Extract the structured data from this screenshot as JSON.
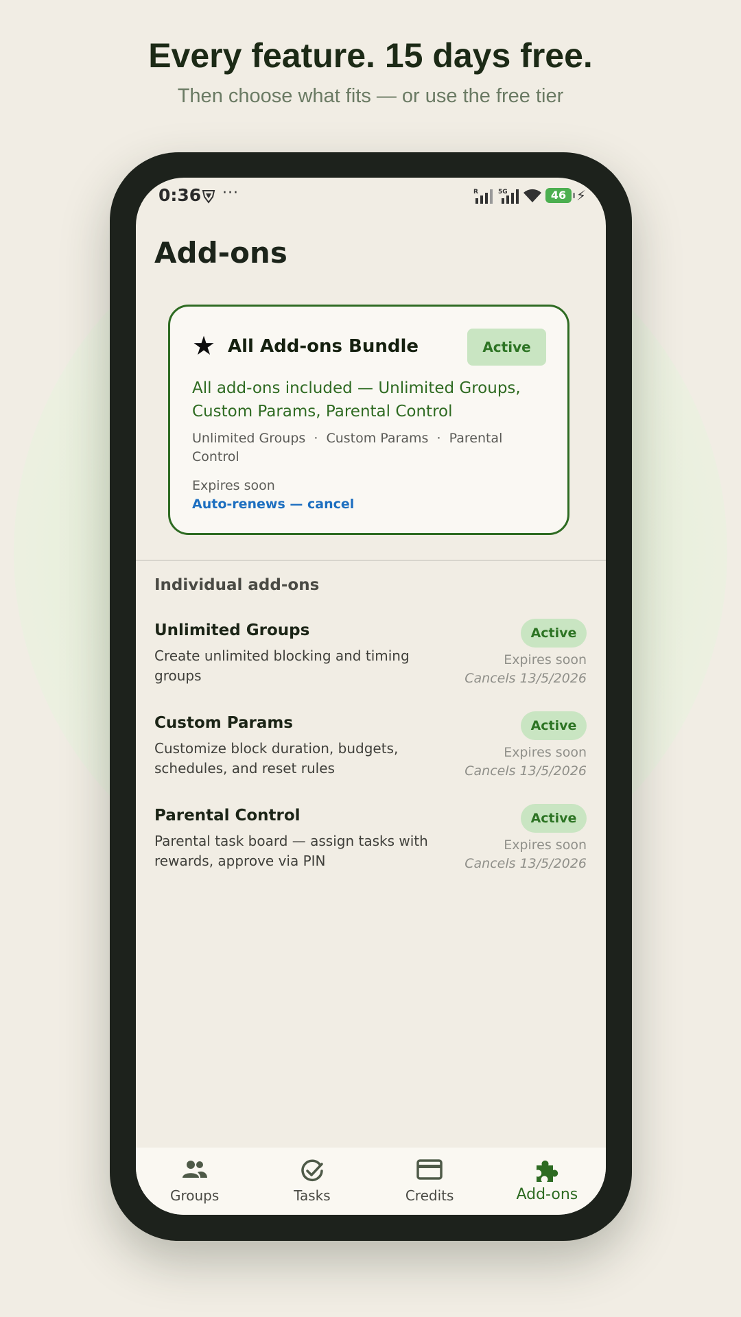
{
  "promo": {
    "headline": "Every feature. 15 days free.",
    "subheadline": "Then choose what fits — or use the free tier"
  },
  "status_bar": {
    "time": "0:36",
    "more": "···",
    "signal_1_label": "R",
    "signal_2_label": "5G",
    "battery": "46"
  },
  "page": {
    "title": "Add-ons"
  },
  "bundle": {
    "title": "All Add-ons Bundle",
    "badge": "Active",
    "description": "All add-ons included — Unlimited Groups, Custom Params, Parental Control",
    "features": "Unlimited Groups  ·  Custom Params  ·  Parental Control",
    "expiry": "Expires soon",
    "cancel_link": "Auto-renews — cancel"
  },
  "individual": {
    "section_title": "Individual add-ons",
    "items": [
      {
        "name": "Unlimited Groups",
        "description": "Create unlimited blocking and timing groups",
        "badge": "Active",
        "expiry": "Expires soon",
        "cancels": "Cancels 13/5/2026"
      },
      {
        "name": "Custom Params",
        "description": "Customize block duration, budgets, schedules, and reset rules",
        "badge": "Active",
        "expiry": "Expires soon",
        "cancels": "Cancels 13/5/2026"
      },
      {
        "name": "Parental Control",
        "description": "Parental task board — assign tasks with rewards, approve via PIN",
        "badge": "Active",
        "expiry": "Expires soon",
        "cancels": "Cancels 13/5/2026"
      }
    ]
  },
  "nav": {
    "items": [
      {
        "label": "Groups",
        "icon": "groups-icon"
      },
      {
        "label": "Tasks",
        "icon": "check-circle-icon"
      },
      {
        "label": "Credits",
        "icon": "credit-card-icon"
      },
      {
        "label": "Add-ons",
        "icon": "puzzle-icon",
        "active": true
      }
    ]
  },
  "colors": {
    "background": "#f1ede4",
    "accent_green": "#2d6b22",
    "badge_green": "#c9e5c2",
    "link_blue": "#1d6fc0",
    "phone_frame": "#1d221c"
  }
}
